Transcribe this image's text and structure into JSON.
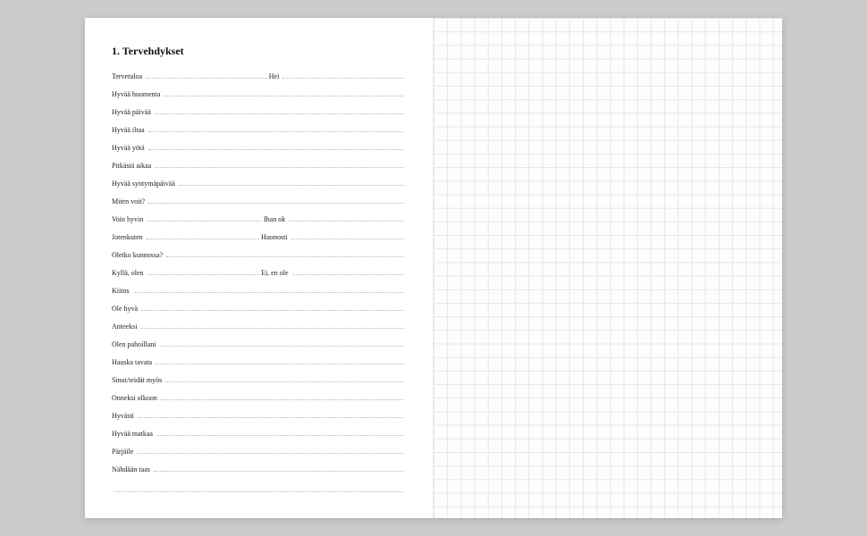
{
  "heading": "1. Tervehdykset",
  "entries": [
    {
      "type": "pair",
      "left": "Tervetuloa",
      "right": "Hei"
    },
    {
      "type": "single",
      "left": "Hyvää huomenta"
    },
    {
      "type": "single",
      "left": "Hyvää päivää"
    },
    {
      "type": "single",
      "left": "Hyvää iltaa"
    },
    {
      "type": "single",
      "left": "Hyvää yötä"
    },
    {
      "type": "single",
      "left": "Pitkästä aikaa"
    },
    {
      "type": "single",
      "left": "Hyvää syntymäpäivää"
    },
    {
      "type": "single",
      "left": "Miten voit?"
    },
    {
      "type": "pair",
      "left": "Voin hyvin",
      "right": "Ihan ok"
    },
    {
      "type": "pair",
      "left": "Jotenkuten",
      "right": "Huonosti"
    },
    {
      "type": "single",
      "left": "Oletko kunnossa?"
    },
    {
      "type": "pair",
      "left": "Kyllä, olen",
      "right": "Ei, en ole"
    },
    {
      "type": "single",
      "left": "Kiitos"
    },
    {
      "type": "single",
      "left": "Ole hyvä"
    },
    {
      "type": "single",
      "left": "Anteeksi"
    },
    {
      "type": "single",
      "left": "Olen pahoillani"
    },
    {
      "type": "single",
      "left": "Hauska tavata"
    },
    {
      "type": "single",
      "left": "Sinut/teidät myös"
    },
    {
      "type": "single",
      "left": "Onneksi olkoon"
    },
    {
      "type": "single",
      "left": "Hyvästi"
    },
    {
      "type": "single",
      "left": "Hyvää matkaa"
    },
    {
      "type": "single",
      "left": "Pärjäile"
    },
    {
      "type": "single",
      "left": "Nähdään taas"
    }
  ],
  "colors": {
    "page_bg": "#ffffff",
    "body_bg": "#c9cbcc",
    "dot_color": "#a9b8c8",
    "grid_color": "#e6e6e6",
    "text_color": "#222222"
  }
}
